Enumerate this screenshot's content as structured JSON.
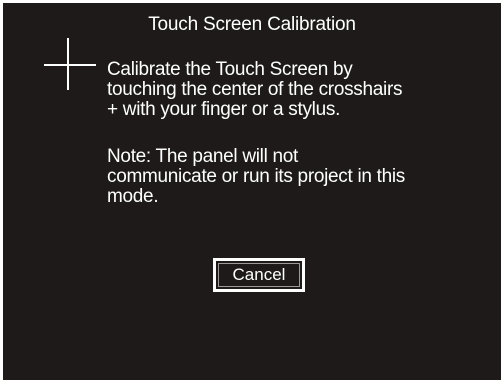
{
  "dialog": {
    "title": "Touch Screen Calibration",
    "instructions": "Calibrate the Touch Screen by\ntouching the center of the crosshairs\n+ with your finger or a stylus.",
    "note": "Note: The panel will not\ncommunicate or run its project in this\nmode.",
    "cancel_label": "Cancel"
  },
  "icons": {
    "crosshair": "crosshair-icon"
  },
  "colors": {
    "background": "#1e1a1a",
    "text": "#ffffff",
    "frame": "#ffffff"
  }
}
